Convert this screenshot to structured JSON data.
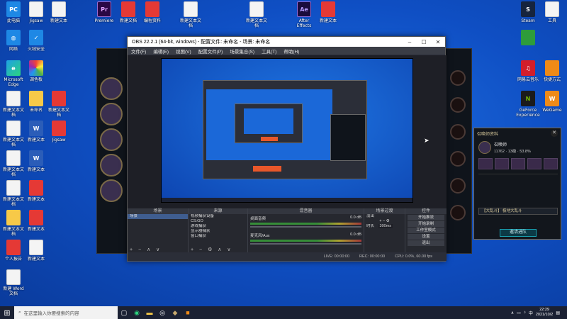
{
  "desktop_icons_left": [
    {
      "label": "此电脑",
      "glyph": "PC",
      "style": "g-shield"
    },
    {
      "label": "网络",
      "glyph": "◍",
      "style": "g-shield"
    },
    {
      "label": "Microsoft Edge",
      "glyph": "e",
      "style": "g-edge"
    },
    {
      "label": "新建文本文档",
      "glyph": "",
      "style": "g-doc"
    },
    {
      "label": "新建文本文档",
      "glyph": "",
      "style": "g-doc"
    },
    {
      "label": "新建文本文档",
      "glyph": "",
      "style": "g-doc"
    },
    {
      "label": "新建文本文档",
      "glyph": "",
      "style": "g-doc"
    },
    {
      "label": "新建文本文档",
      "glyph": "",
      "style": "g-doc"
    },
    {
      "label": "个人报告",
      "glyph": "",
      "style": "g-doc"
    },
    {
      "label": "新建 Word 文档",
      "glyph": "",
      "style": "g-doc"
    },
    {
      "label": "新建文本文档",
      "glyph": "",
      "style": "g-doc"
    }
  ],
  "desktop_icons_col2": [
    {
      "label": "Jigsaw",
      "glyph": "",
      "style": "g-doc"
    },
    {
      "label": "火绒安全",
      "glyph": "✓",
      "style": "g-shield"
    },
    {
      "label": "调色板",
      "glyph": "",
      "style": "g-color"
    },
    {
      "label": "未命名",
      "glyph": "",
      "style": "g-doc"
    },
    {
      "label": "新建文本",
      "glyph": "",
      "style": "g-doc"
    },
    {
      "label": "新建文本",
      "glyph": "W",
      "style": "g-word"
    },
    {
      "label": "新建文本",
      "glyph": "W",
      "style": "g-word"
    },
    {
      "label": "新建文本",
      "glyph": "",
      "style": "g-pdf"
    },
    {
      "label": "新建文本",
      "glyph": "",
      "style": "g-pdf"
    },
    {
      "label": "新建文本",
      "glyph": "",
      "style": "g-doc"
    }
  ],
  "desktop_icons_top": [
    {
      "label": "Premiere",
      "glyph": "Pr",
      "style": "g-pr"
    },
    {
      "label": "新建文档",
      "glyph": "",
      "style": "g-pdf"
    },
    {
      "label": "编程资料",
      "glyph": "",
      "style": "g-pdf"
    },
    {
      "label": "新建文本文档",
      "glyph": "",
      "style": "g-doc"
    },
    {
      "label": "新建文本文档",
      "glyph": "",
      "style": "g-doc"
    },
    {
      "label": "After Effects",
      "glyph": "Ae",
      "style": "g-ae"
    },
    {
      "label": "新建文本",
      "glyph": "",
      "style": "g-pdf"
    }
  ],
  "desktop_icons_right": [
    {
      "label": "Steam",
      "glyph": "S",
      "style": "g-steam"
    },
    {
      "label": "工具",
      "glyph": "",
      "style": "g-doc"
    },
    {
      "label": "网易云音乐",
      "glyph": "♫",
      "style": "g-red"
    },
    {
      "label": "快捷方式",
      "glyph": "",
      "style": "g-orange"
    },
    {
      "label": "GeForce Experience",
      "glyph": "N",
      "style": "g-nvidia"
    },
    {
      "label": "WeGame",
      "glyph": "W",
      "style": "g-orange"
    }
  ],
  "obs": {
    "title": "OBS 22.2.1 (64-bit, windows) - 配置文件: 未命名 - 场景: 未命名",
    "menus": [
      "文件(F)",
      "编辑(E)",
      "视图(V)",
      "配置文件(P)",
      "场景集合(S)",
      "工具(T)",
      "帮助(H)"
    ],
    "docks": {
      "scenes_title": "场景",
      "scenes": [
        "场景"
      ],
      "sources_title": "来源",
      "sources": [
        "视频捕获设备",
        "CS:GO",
        "游戏捕获",
        "显示器捕获",
        "窗口捕获"
      ],
      "mixer_title": "混音器",
      "mixer": [
        {
          "name": "桌面音频",
          "level": "0.0 dB"
        },
        {
          "name": "麦克风/Aux",
          "level": "0.0 dB"
        }
      ],
      "transitions_title": "场景过渡",
      "transition_name": "淡出",
      "duration_label": "时长",
      "duration": "300ms",
      "controls_title": "控件",
      "controls": [
        "开始推流",
        "开始录制",
        "工作室模式",
        "设置",
        "退出"
      ]
    },
    "status": {
      "live": "LIVE: 00:00:00",
      "rec": "REC: 00:00:00",
      "cpu": "CPU: 0.0%, 60.00 fps"
    }
  },
  "profile_panel": {
    "title": "召唤师资料",
    "name": "召唤师",
    "stats": "11762 · 13级 · 53.8%",
    "mode_select": "【大乱斗】 极地大乱斗",
    "action": "邀请进队"
  },
  "taskbar": {
    "search_placeholder": "在这里输入你要搜索的内容",
    "time": "22:29",
    "date": "2021/10/2",
    "apps": [
      "task-view-icon",
      "edge-icon",
      "explorer-icon",
      "obs-icon",
      "game-icon",
      "app-icon"
    ]
  }
}
